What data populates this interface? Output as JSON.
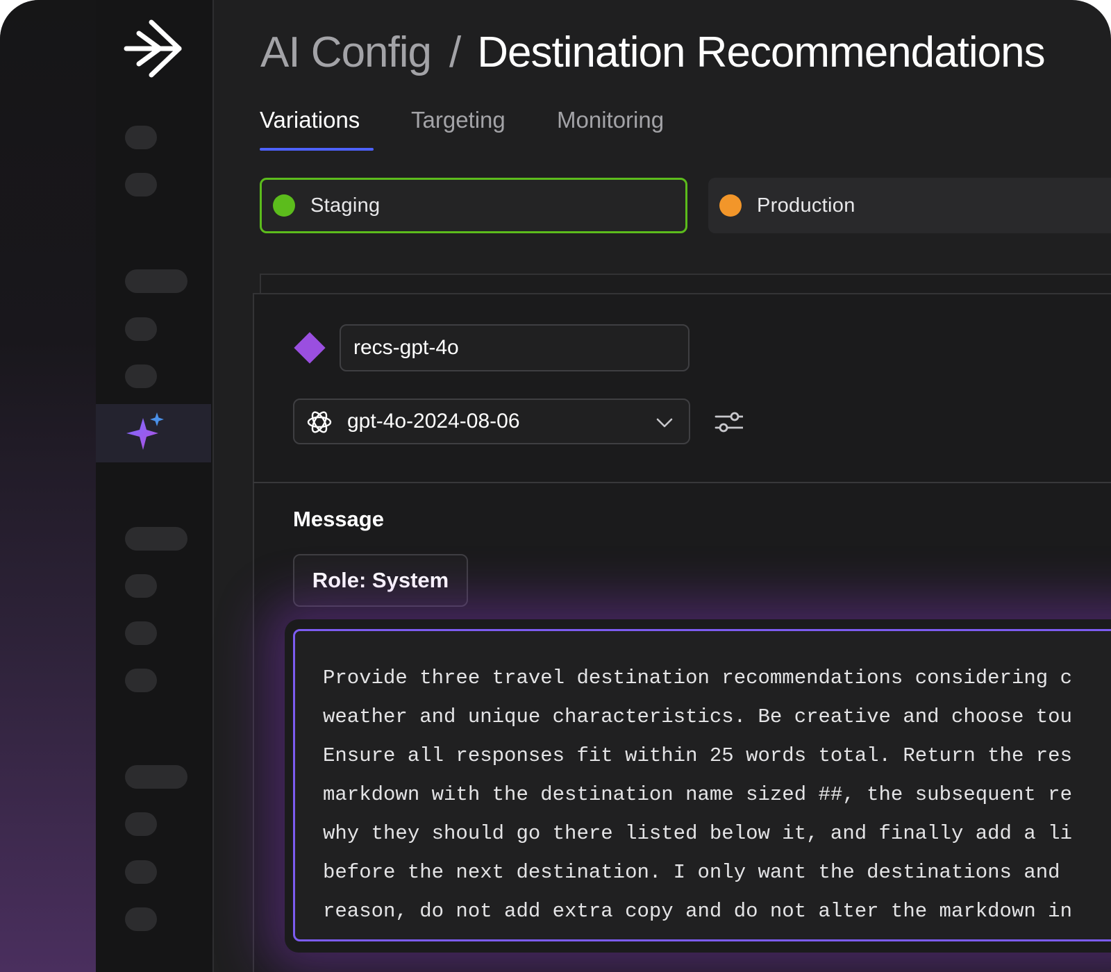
{
  "breadcrumb": {
    "parent": "AI Config",
    "separator": "/",
    "current": "Destination Recommendations"
  },
  "tabs": [
    {
      "label": "Variations",
      "active": true
    },
    {
      "label": "Targeting",
      "active": false
    },
    {
      "label": "Monitoring",
      "active": false
    }
  ],
  "environments": [
    {
      "label": "Staging",
      "color": "#5cbc1c",
      "selected": true
    },
    {
      "label": "Production",
      "color": "#f2962a",
      "selected": false
    }
  ],
  "variation": {
    "name": "recs-gpt-4o",
    "model": "gpt-4o-2024-08-06",
    "model_icon": "openai-icon",
    "diamond_color": "#9a4fe0"
  },
  "message": {
    "heading": "Message",
    "role_label": "Role: System",
    "lines": [
      "Provide three travel destination recommendations considering c",
      "weather and unique characteristics. Be creative and choose tou",
      "Ensure all responses fit within 25 words total. Return the res",
      "markdown with the destination name sized ##, the subsequent re",
      "why they should go there listed below it, and finally add a li",
      "before the next destination. I only want the destinations and",
      "reason, do not add extra copy and do not alter the markdown in"
    ]
  },
  "colors": {
    "accent": "#4d62ff",
    "prompt_border": "#7c5cf0"
  }
}
